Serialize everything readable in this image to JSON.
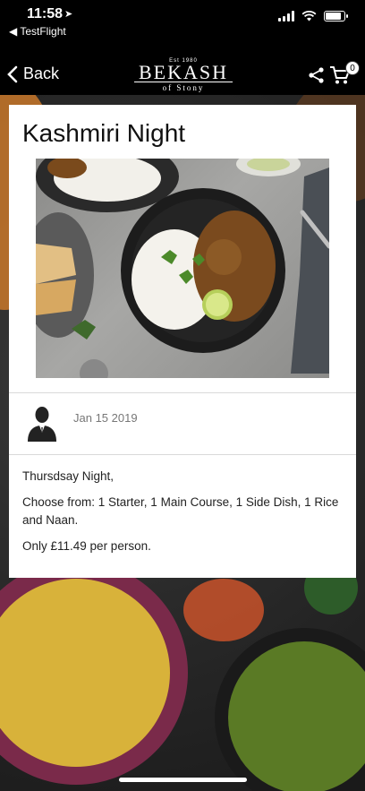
{
  "status_bar": {
    "time": "11:58",
    "back_app": "◀ TestFlight"
  },
  "nav": {
    "back_label": "Back",
    "logo": {
      "est": "Est 1980",
      "name": "BEKASH",
      "sub": "of Stony"
    },
    "cart_count": "0"
  },
  "post": {
    "title": "Kashmiri Night",
    "date": "Jan 15 2019",
    "body": [
      "Thursdsay Night,",
      "Choose from: 1 Starter, 1 Main Course, 1 Side Dish, 1 Rice and Naan.",
      "Only £11.49 per person."
    ]
  },
  "icons": {
    "location": "location-arrow-icon",
    "signal": "cellular-signal-icon",
    "wifi": "wifi-icon",
    "battery": "battery-icon",
    "back": "chevron-left-icon",
    "share": "share-icon",
    "cart": "cart-icon",
    "author": "user-avatar-icon"
  }
}
